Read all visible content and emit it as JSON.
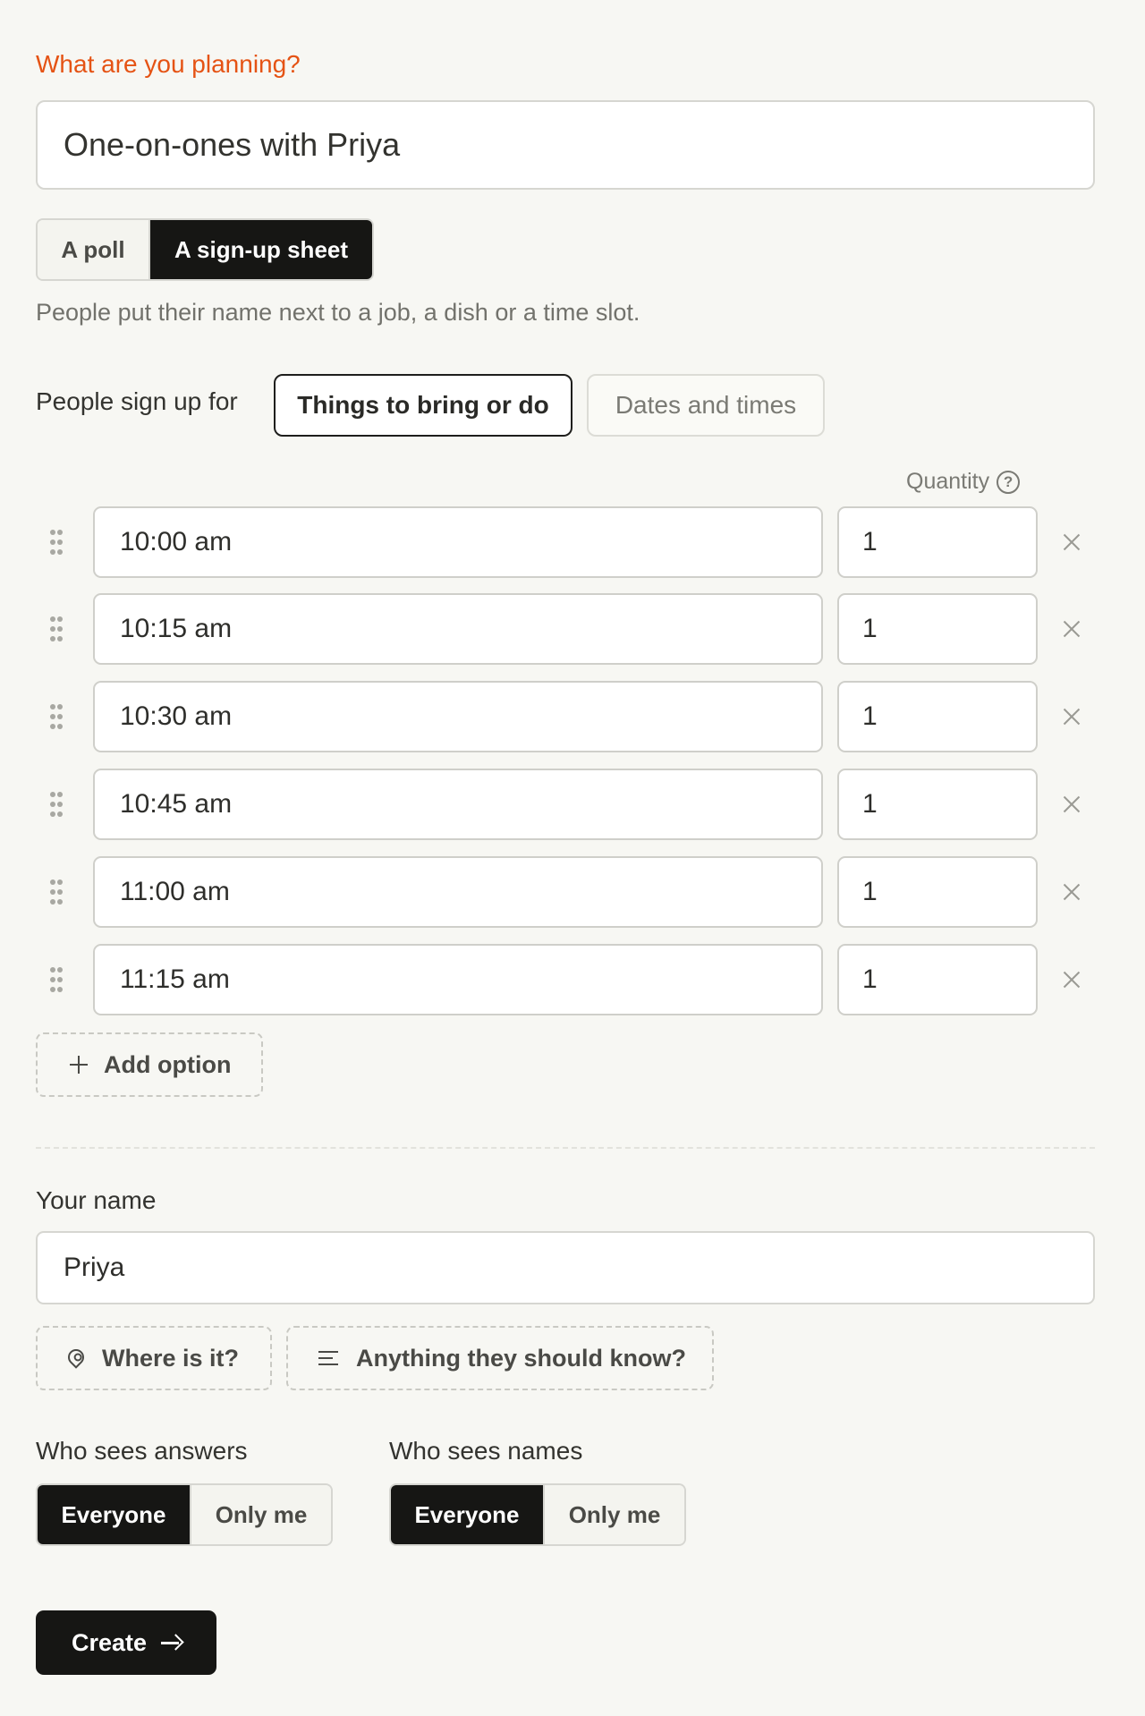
{
  "form": {
    "question_label": "What are you planning?",
    "title_value": "One-on-ones with Priya"
  },
  "mode_toggle": {
    "poll_label": "A poll",
    "signup_label": "A sign-up sheet",
    "selected": "signup"
  },
  "mode_hint": "People put their name next to a job, a dish or a time slot.",
  "signup_type": {
    "label": "People sign up for",
    "options": [
      "Things to bring or do",
      "Dates and times"
    ],
    "selected": "Things to bring or do"
  },
  "options_table": {
    "quantity_header": "Quantity",
    "rows": [
      {
        "label": "10:00 am",
        "quantity": "1"
      },
      {
        "label": "10:15 am",
        "quantity": "1"
      },
      {
        "label": "10:30 am",
        "quantity": "1"
      },
      {
        "label": "10:45 am",
        "quantity": "1"
      },
      {
        "label": "11:00 am",
        "quantity": "1"
      },
      {
        "label": "11:15 am",
        "quantity": "1"
      }
    ],
    "add_label": "Add option"
  },
  "organizer": {
    "name_label": "Your name",
    "name_value": "Priya"
  },
  "extras": {
    "location_label": "Where is it?",
    "notes_label": "Anything they should know?"
  },
  "visibility": {
    "answers_label": "Who sees answers",
    "names_label": "Who sees names",
    "everyone_label": "Everyone",
    "only_me_label": "Only me",
    "answers_selected": "Everyone",
    "names_selected": "Everyone"
  },
  "submit": {
    "create_label": "Create"
  },
  "colors": {
    "accent": "#e55314",
    "dark": "#161614",
    "background": "#f7f7f3"
  }
}
